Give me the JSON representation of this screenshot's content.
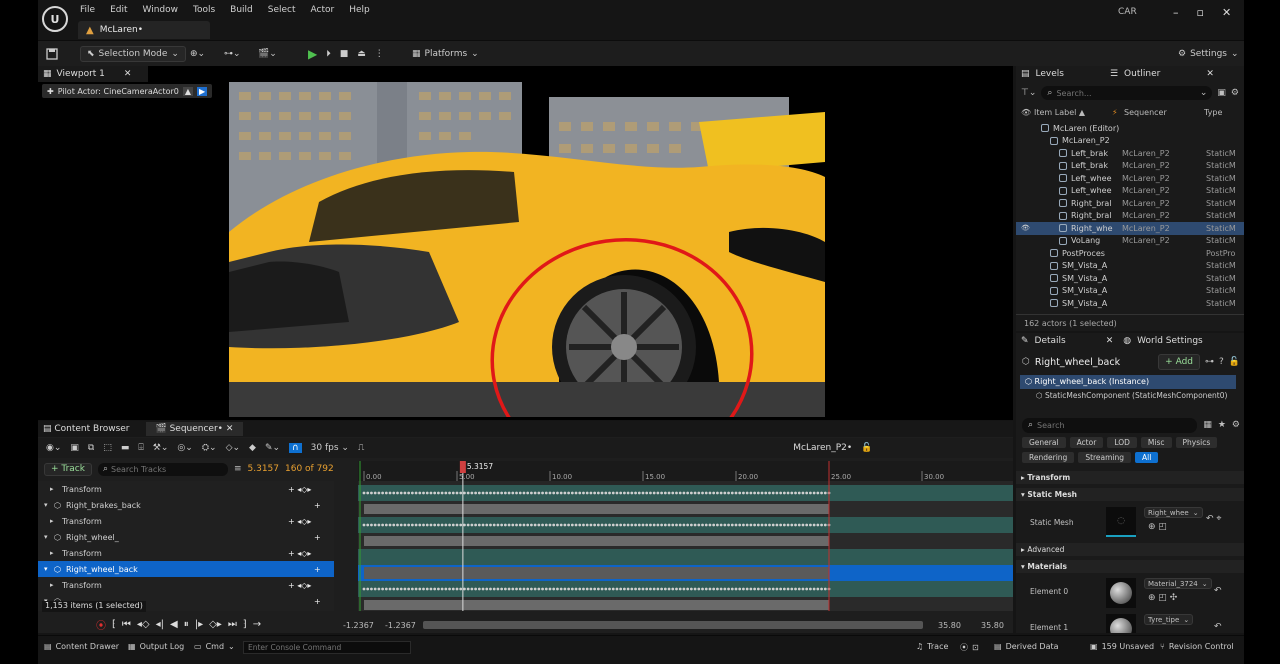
{
  "menubar": {
    "items": [
      "File",
      "Edit",
      "Window",
      "Tools",
      "Build",
      "Select",
      "Actor",
      "Help"
    ],
    "doc_tab": "McLaren•",
    "project": "CAR"
  },
  "toolbar": {
    "selection_mode": "Selection Mode",
    "platforms": "Platforms",
    "settings": "Settings"
  },
  "viewport": {
    "tab": "Viewport 1",
    "pilot": "Pilot Actor: CineCameraActor0"
  },
  "outliner": {
    "levels_tab": "Levels",
    "outliner_tab": "Outliner",
    "search_placeholder": "Search...",
    "col_label": "Item Label ▲",
    "col_seq": "Sequencer",
    "col_type": "Type",
    "rows": [
      {
        "name": "McLaren (Editor)",
        "level": "",
        "type": "",
        "indent": 1
      },
      {
        "name": "McLaren_P2",
        "level": "",
        "type": "",
        "indent": 2
      },
      {
        "name": "Left_brak",
        "level": "McLaren_P2",
        "type": "StaticM",
        "indent": 3
      },
      {
        "name": "Left_brak",
        "level": "McLaren_P2",
        "type": "StaticM",
        "indent": 3
      },
      {
        "name": "Left_whee",
        "level": "McLaren_P2",
        "type": "StaticM",
        "indent": 3
      },
      {
        "name": "Left_whee",
        "level": "McLaren_P2",
        "type": "StaticM",
        "indent": 3
      },
      {
        "name": "Right_bral",
        "level": "McLaren_P2",
        "type": "StaticM",
        "indent": 3
      },
      {
        "name": "Right_bral",
        "level": "McLaren_P2",
        "type": "StaticM",
        "indent": 3
      },
      {
        "name": "Right_whe",
        "level": "McLaren_P2",
        "type": "StaticM",
        "indent": 3,
        "selected": true
      },
      {
        "name": "VoLang",
        "level": "McLaren_P2",
        "type": "StaticM",
        "indent": 3
      },
      {
        "name": "PostProces",
        "level": "",
        "type": "PostPro",
        "indent": 2
      },
      {
        "name": "SM_Vista_A",
        "level": "",
        "type": "StaticM",
        "indent": 2
      },
      {
        "name": "SM_Vista_A",
        "level": "",
        "type": "StaticM",
        "indent": 2
      },
      {
        "name": "SM_Vista_A",
        "level": "",
        "type": "StaticM",
        "indent": 2
      },
      {
        "name": "SM_Vista_A",
        "level": "",
        "type": "StaticM",
        "indent": 2
      }
    ],
    "count": "162 actors (1 selected)"
  },
  "details": {
    "details_tab": "Details",
    "world_tab": "World Settings",
    "object": "Right_wheel_back",
    "add": "+ Add",
    "instance": "Right_wheel_back (Instance)",
    "component": "StaticMeshComponent (StaticMeshComponent0)",
    "search_placeholder": "Search",
    "filters": [
      "General",
      "Actor",
      "LOD",
      "Misc",
      "Physics",
      "Rendering",
      "Streaming",
      "All"
    ],
    "sections": {
      "transform": "Transform",
      "static_mesh": "Static Mesh",
      "advanced": "Advanced",
      "materials": "Materials"
    },
    "static_mesh_label": "Static Mesh",
    "static_mesh_value": "Right_whee",
    "el0_label": "Element 0",
    "el0_value": "Material_3724",
    "el1_label": "Element 1",
    "el1_value": "Tyre_tipe"
  },
  "sequencer": {
    "cb_tab": "Content Browser",
    "seq_tab": "Sequencer•",
    "fps": "30 fps",
    "seq_name": "McLaren_P2•",
    "add_track": "+ Track",
    "search_placeholder": "Search Tracks",
    "time": "5.3157",
    "frames": "160 of 792",
    "playhead": "5.3157",
    "ticks": [
      "0.00",
      "5.00",
      "10.00",
      "15.00",
      "20.00",
      "25.00",
      "30.00",
      "35.0"
    ],
    "tracks": [
      {
        "name": "Transform",
        "indent": 2,
        "type": "transform"
      },
      {
        "name": "Right_brakes_back",
        "indent": 1,
        "type": "object"
      },
      {
        "name": "Transform",
        "indent": 2,
        "type": "transform"
      },
      {
        "name": "Right_wheel_",
        "indent": 1,
        "type": "object"
      },
      {
        "name": "Transform",
        "indent": 2,
        "type": "transform"
      },
      {
        "name": "Right_wheel_back",
        "indent": 1,
        "type": "object",
        "selected": true
      },
      {
        "name": "Transform",
        "indent": 2,
        "type": "transform"
      },
      {
        "name": "",
        "indent": 1,
        "type": "object"
      }
    ],
    "items": "1,153 items (1 selected)",
    "range_start": "-1.2367",
    "range_start2": "-1.2367",
    "range_end": "35.80",
    "range_end2": "35.80"
  },
  "statusbar": {
    "content_drawer": "Content Drawer",
    "output_log": "Output Log",
    "cmd": "Cmd",
    "console_placeholder": "Enter Console Command",
    "trace": "Trace",
    "derived": "Derived Data",
    "unsaved": "159 Unsaved",
    "revision": "Revision Control"
  }
}
